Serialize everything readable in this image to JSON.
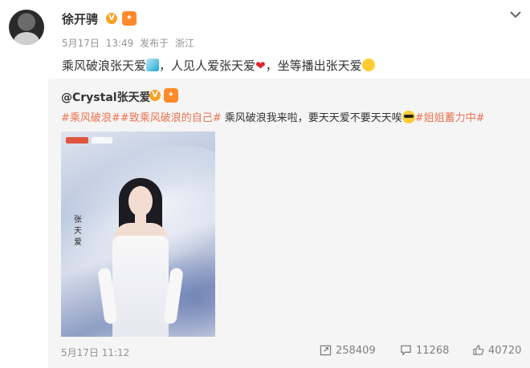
{
  "post": {
    "username": "徐开骋",
    "date": "5月17日",
    "time": "13:49",
    "published_label": "发布于",
    "location": "浙江",
    "text_part1": "乘风破浪张天爱",
    "text_part2": "，人见人爱张天爱",
    "text_part3": "，坐等播出张天爱"
  },
  "repost": {
    "user_handle": "@Crystal张天爱",
    "tag1": "#乘风破浪#",
    "tag2": "#致乘风破浪的自己#",
    "text_mid": "乘风破浪我来啦，要天天爱不要天天唉",
    "tag3": "#姐姐蓄力中#",
    "poster_calligraphy": "张天爱",
    "date": "5月17日",
    "time": "11:12",
    "reposts": "258409",
    "comments": "11268",
    "likes": "40720"
  },
  "icons": {
    "verified": "v-verified-badge",
    "level": "member-level-badge",
    "more": "chevron-down-icon",
    "wave": "wave-emoji",
    "heart": "heart-emoji",
    "muscle": "flexed-arm-emoji",
    "cool": "sunglasses-emoji",
    "repost": "repost-icon",
    "comment": "comment-icon",
    "like": "thumbs-up-icon"
  },
  "colors": {
    "tag": "#eb7350",
    "verified": "#f7a127",
    "repost_bg": "#f5f5f5",
    "meta": "#939393"
  }
}
